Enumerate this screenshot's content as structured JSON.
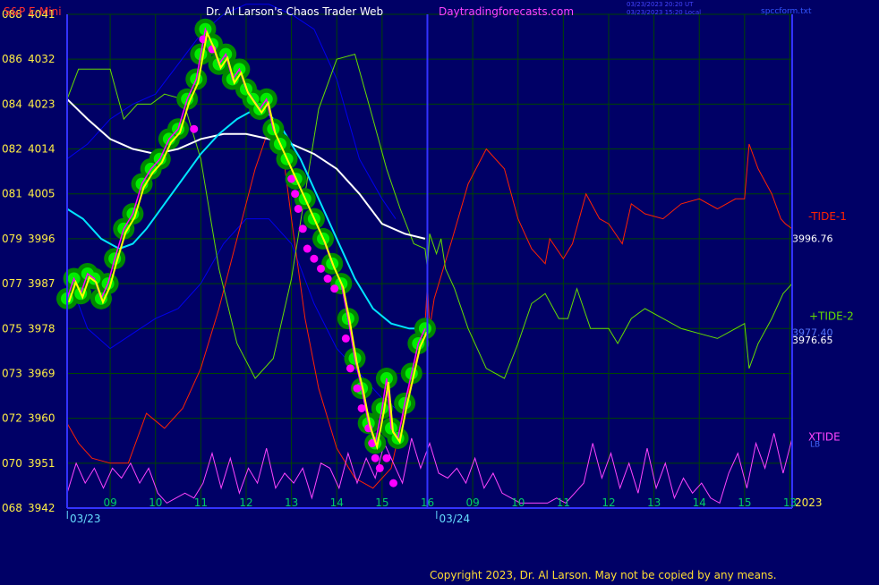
{
  "header": {
    "symbol": "S&P E-Mini",
    "author": "Dr. Al Larson's Chaos Trader Web",
    "site": "Daytradingforecasts.com",
    "time_ut": "03/23/2023 20:20 UT",
    "time_local": "03/23/2023 15:20 Local",
    "file": "spccform.txt"
  },
  "footer": {
    "copyright": "Copyright 2023, Dr. Al Larson. May not be copied by any means."
  },
  "colors": {
    "background": "#000066",
    "grid": "#004400",
    "frame": "#3333ff",
    "price_yellow": "#ffff00",
    "price_fill": "#00ee00",
    "price_shadow": "#008800",
    "markers": "#ff00ff",
    "tide1": "#ff2200",
    "tide2": "#66dd00",
    "xtide": "#ff44ff",
    "avg_cyan": "#00e5ff",
    "avg_white": "#ffffff",
    "band_blue": "#0000ee",
    "tick_text": "#ffee44",
    "date_text": "#66ddff",
    "hour_text": "#00cc66",
    "symbol_text": "#ff3030",
    "author_text": "#ffffff",
    "site_text": "#ff44ff"
  },
  "chart_data": {
    "type": "line",
    "y_ticks": [
      {
        "left": "088",
        "right": "4041",
        "value": 4041
      },
      {
        "left": "086",
        "right": "4032",
        "value": 4032
      },
      {
        "left": "084",
        "right": "4023",
        "value": 4023
      },
      {
        "left": "082",
        "right": "4014",
        "value": 4014
      },
      {
        "left": "081",
        "right": "4005",
        "value": 4005
      },
      {
        "left": "079",
        "right": "3996",
        "value": 3996
      },
      {
        "left": "077",
        "right": "3987",
        "value": 3987
      },
      {
        "left": "075",
        "right": "3978",
        "value": 3978
      },
      {
        "left": "073",
        "right": "3969",
        "value": 3969
      },
      {
        "left": "072",
        "right": "3960",
        "value": 3960
      },
      {
        "left": "070",
        "right": "3951",
        "value": 3951
      },
      {
        "left": "068",
        "right": "3942",
        "value": 3942
      }
    ],
    "ylim": [
      3942,
      4041
    ],
    "x_ticks": [
      {
        "label": "09",
        "t": 9
      },
      {
        "label": "10",
        "t": 10
      },
      {
        "label": "11",
        "t": 11
      },
      {
        "label": "12",
        "t": 12
      },
      {
        "label": "13",
        "t": 13
      },
      {
        "label": "14",
        "t": 14
      },
      {
        "label": "15",
        "t": 15
      },
      {
        "label": "16",
        "t": 16
      },
      {
        "label": "09",
        "t": 17
      },
      {
        "label": "10",
        "t": 18
      },
      {
        "label": "11",
        "t": 19
      },
      {
        "label": "12",
        "t": 20
      },
      {
        "label": "13",
        "t": 21
      },
      {
        "label": "14",
        "t": 22
      },
      {
        "label": "15",
        "t": 23
      },
      {
        "label": "13",
        "t": 24
      }
    ],
    "xlim": [
      8.05,
      24.05
    ],
    "date_labels": [
      {
        "label": "03/23",
        "t": 8.45
      },
      {
        "label": "03/24",
        "t": 16.6
      }
    ],
    "year_label": "2023",
    "price": {
      "x": [
        8.05,
        8.2,
        8.35,
        8.5,
        8.65,
        8.8,
        8.95,
        9.1,
        9.3,
        9.5,
        9.7,
        9.9,
        10.1,
        10.3,
        10.5,
        10.7,
        10.9,
        11.0,
        11.1,
        11.25,
        11.4,
        11.55,
        11.7,
        11.85,
        12.0,
        12.15,
        12.3,
        12.45,
        12.6,
        12.75,
        12.9,
        13.1,
        13.3,
        13.5,
        13.7,
        13.9,
        14.1,
        14.25,
        14.4,
        14.55,
        14.7,
        14.85,
        15.0,
        15.1,
        15.2,
        15.35,
        15.5,
        15.65,
        15.8,
        15.95
      ],
      "y": [
        3984,
        3988,
        3985,
        3989,
        3988,
        3984,
        3987,
        3992,
        3998,
        4001,
        4007,
        4010,
        4012,
        4016,
        4018,
        4024,
        4028,
        4033,
        4038,
        4035,
        4031,
        4033,
        4028,
        4030,
        4026,
        4024,
        4022,
        4024,
        4018,
        4015,
        4012,
        4008,
        4004,
        4000,
        3996,
        3991,
        3987,
        3980,
        3972,
        3966,
        3959,
        3955,
        3962,
        3968,
        3958,
        3956,
        3963,
        3969,
        3975,
        3978
      ]
    },
    "tide1": {
      "name": "-TIDE-1",
      "x": [
        8.05,
        8.3,
        8.6,
        9.0,
        9.4,
        9.8,
        10.2,
        10.6,
        11.0,
        11.4,
        11.8,
        12.2,
        12.5,
        12.8,
        13.0,
        13.3,
        13.6,
        14.0,
        14.4,
        14.8,
        15.2,
        15.6,
        15.95,
        16.0,
        16.05,
        16.15,
        16.35,
        16.55,
        16.9,
        17.3,
        17.7,
        18.0,
        18.3,
        18.6,
        18.7,
        19.0,
        19.2,
        19.5,
        19.8,
        20.0,
        20.3,
        20.5,
        20.8,
        21.2,
        21.6,
        22.0,
        22.4,
        22.8,
        23.0,
        23.1,
        23.3,
        23.6,
        23.8,
        23.9,
        24.05
      ],
      "y": [
        3959,
        3955,
        3952,
        3951,
        3951,
        3961,
        3958,
        3962,
        3970,
        3982,
        3996,
        4010,
        4018,
        4014,
        4000,
        3980,
        3966,
        3954,
        3948,
        3946,
        3950,
        3966,
        3979,
        3987,
        3978,
        3984,
        3990,
        3996,
        4007,
        4014,
        4010,
        4000,
        3994,
        3991,
        3996,
        3992,
        3995,
        4005,
        4000,
        3999,
        3995,
        4003,
        4001,
        4000,
        4003,
        4004,
        4002,
        4004,
        4004,
        4015,
        4010,
        4005,
        4000,
        3999,
        3998
      ]
    },
    "tide2": {
      "name": "+TIDE-2",
      "x": [
        8.05,
        8.3,
        8.6,
        9.0,
        9.3,
        9.6,
        9.9,
        10.2,
        10.6,
        11.0,
        11.4,
        11.8,
        12.2,
        12.6,
        13.0,
        13.3,
        13.6,
        14.0,
        14.4,
        14.8,
        15.1,
        15.4,
        15.7,
        15.95,
        16.0,
        16.05,
        16.2,
        16.3,
        16.4,
        16.6,
        16.9,
        17.3,
        17.7,
        18.0,
        18.3,
        18.6,
        18.9,
        19.1,
        19.3,
        19.6,
        20.0,
        20.2,
        20.5,
        20.8,
        21.2,
        21.6,
        22.0,
        22.4,
        22.8,
        23.0,
        23.1,
        23.3,
        23.6,
        23.85,
        24.05
      ],
      "y": [
        4024,
        4030,
        4030,
        4030,
        4020,
        4023,
        4023,
        4025,
        4024,
        4012,
        3990,
        3975,
        3968,
        3972,
        3988,
        4005,
        4022,
        4032,
        4033,
        4020,
        4010,
        4002,
        3995,
        3994,
        3990,
        3997,
        3993,
        3996,
        3990,
        3986,
        3978,
        3970,
        3968,
        3975,
        3983,
        3985,
        3980,
        3980,
        3986,
        3978,
        3978,
        3975,
        3980,
        3982,
        3980,
        3978,
        3977,
        3976,
        3978,
        3979,
        3970,
        3975,
        3980,
        3985,
        3987
      ]
    },
    "xtide": {
      "name": "XTIDE",
      "x": [
        8.05,
        8.25,
        8.45,
        8.65,
        8.85,
        9.05,
        9.25,
        9.45,
        9.65,
        9.85,
        10.05,
        10.25,
        10.45,
        10.65,
        10.85,
        11.05,
        11.25,
        11.45,
        11.65,
        11.85,
        12.05,
        12.25,
        12.45,
        12.65,
        12.85,
        13.05,
        13.25,
        13.45,
        13.65,
        13.85,
        14.05,
        14.25,
        14.45,
        14.65,
        14.85,
        15.05,
        15.25,
        15.45,
        15.65,
        15.85,
        16.05,
        16.25,
        16.45,
        16.65,
        16.85,
        17.05,
        17.25,
        17.45,
        17.65,
        17.85,
        18.05,
        18.25,
        18.45,
        18.65,
        18.85,
        19.05,
        19.25,
        19.45,
        19.65,
        19.85,
        20.05,
        20.25,
        20.45,
        20.65,
        20.85,
        21.05,
        21.25,
        21.45,
        21.65,
        21.85,
        22.05,
        22.25,
        22.45,
        22.65,
        22.85,
        23.05,
        23.25,
        23.45,
        23.65,
        23.85,
        24.05
      ],
      "y": [
        3945,
        3951,
        3947,
        3950,
        3946,
        3950,
        3948,
        3951,
        3947,
        3950,
        3945,
        3943,
        3944,
        3945,
        3944,
        3947,
        3953,
        3946,
        3952,
        3945,
        3950,
        3947,
        3954,
        3946,
        3949,
        3947,
        3950,
        3944,
        3951,
        3950,
        3946,
        3953,
        3947,
        3952,
        3948,
        3955,
        3951,
        3947,
        3956,
        3950,
        3955,
        3949,
        3948,
        3950,
        3947,
        3952,
        3946,
        3949,
        3945,
        3944,
        3943,
        3943,
        3943,
        3943,
        3944,
        3943,
        3945,
        3947,
        3955,
        3948,
        3953,
        3946,
        3951,
        3945,
        3954,
        3946,
        3951,
        3944,
        3948,
        3945,
        3947,
        3944,
        3943,
        3949,
        3953,
        3946,
        3955,
        3950,
        3957,
        3949,
        3956
      ]
    },
    "avg_cyan": {
      "x": [
        8.05,
        8.4,
        8.8,
        9.2,
        9.5,
        9.8,
        10.2,
        10.6,
        11.0,
        11.4,
        11.8,
        12.2,
        12.5,
        12.8,
        13.2,
        13.6,
        14.0,
        14.4,
        14.8,
        15.2,
        15.6,
        15.95
      ],
      "y": [
        4002,
        4000,
        3996,
        3994,
        3995,
        3998,
        4003,
        4008,
        4013,
        4017,
        4020,
        4022,
        4021,
        4018,
        4012,
        4004,
        3996,
        3988,
        3982,
        3979,
        3978,
        3978
      ]
    },
    "avg_white": {
      "x": [
        8.05,
        8.5,
        9.0,
        9.5,
        10.0,
        10.5,
        11.0,
        11.5,
        12.0,
        12.5,
        13.0,
        13.5,
        14.0,
        14.5,
        15.0,
        15.5,
        15.95
      ],
      "y": [
        4024,
        4020,
        4016,
        4014,
        4013,
        4014,
        4016,
        4017,
        4017,
        4016,
        4015,
        4013,
        4010,
        4005,
        3999,
        3997,
        3996
      ]
    },
    "band_upper": {
      "x": [
        8.05,
        8.5,
        9.0,
        9.5,
        10.0,
        10.5,
        11.0,
        11.5,
        12.0,
        12.5,
        13.0,
        13.5,
        14.0,
        14.5,
        15.0,
        15.3
      ],
      "y": [
        4012,
        4015,
        4020,
        4023,
        4025,
        4031,
        4037,
        4041,
        4043,
        4043,
        4041,
        4038,
        4028,
        4012,
        4004,
        4000
      ]
    },
    "band_lower": {
      "x": [
        8.05,
        8.5,
        9.0,
        9.5,
        10.0,
        10.5,
        11.0,
        11.5,
        12.0,
        12.5,
        13.0,
        13.5,
        14.0,
        14.5,
        15.0,
        15.3
      ],
      "y": [
        3989,
        3978,
        3974,
        3977,
        3980,
        3982,
        3987,
        3995,
        4000,
        4000,
        3995,
        3983,
        3974,
        3969,
        3964,
        3962
      ]
    },
    "markers": {
      "x": [
        10.85,
        11.05,
        11.25,
        13.0,
        13.08,
        13.15,
        13.25,
        13.35,
        13.5,
        13.65,
        13.8,
        13.95,
        14.2,
        14.3,
        14.45,
        14.55,
        14.7,
        14.78,
        14.85,
        14.95,
        15.1,
        15.25
      ],
      "y": [
        4018,
        4036,
        4034,
        4008,
        4005,
        4002,
        3998,
        3994,
        3992,
        3990,
        3988,
        3986,
        3976,
        3970,
        3966,
        3962,
        3958,
        3955,
        3952,
        3950,
        3952,
        3947
      ]
    },
    "last_values": [
      {
        "text": "3996.76",
        "value": 3996.76
      },
      {
        "text": "3977.40",
        "value": 3977.4
      },
      {
        "text": "3976.65",
        "value": 3976.65
      }
    ],
    "series_labels": [
      {
        "text": "-TIDE-1",
        "value": 4000.5
      },
      {
        "text": "+TIDE-2",
        "value": 3980.5
      },
      {
        "text": "XTIDE",
        "value": 3956.3
      },
      {
        "text": "LB",
        "value": 3955.0
      }
    ]
  }
}
